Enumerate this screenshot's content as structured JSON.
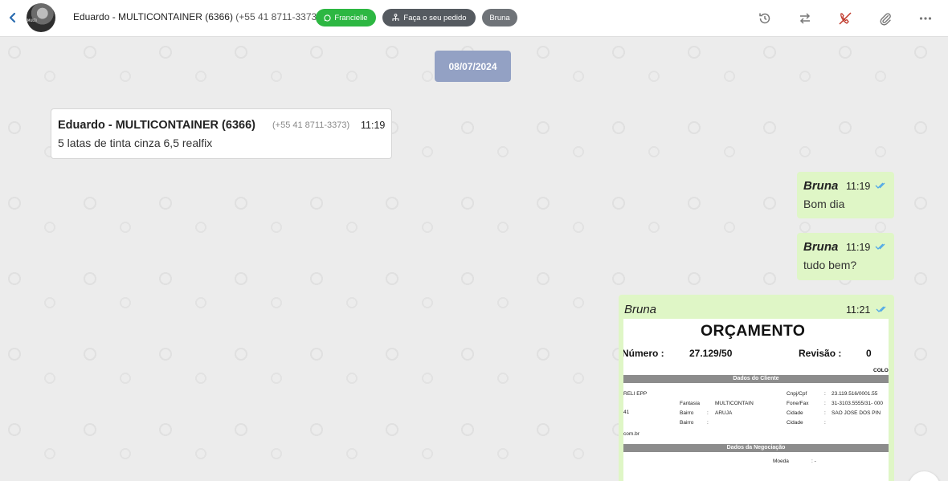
{
  "header": {
    "contact_name": "Eduardo - MULTICONTAINER (6366)",
    "contact_phone": "(+55 41 8711-3373)",
    "pill_whatsapp": "Francielle",
    "pill_order": "Faça o seu pedido",
    "pill_agent": "Bruna",
    "avatar_text": "MULTI",
    "icons": [
      "back-icon",
      "history-icon",
      "transfer-icon",
      "end-call-icon",
      "attachment-icon",
      "more-icon"
    ]
  },
  "chat": {
    "date": "08/07/2024",
    "incoming": {
      "sender": "Eduardo - MULTICONTAINER (6366)",
      "phone": "(+55 41 8711-3373)",
      "time": "11:19",
      "text": "5 latas de tinta cinza 6,5 realfix"
    },
    "outgoing": [
      {
        "sender": "Bruna",
        "time": "11:19",
        "text": "Bom dia"
      },
      {
        "sender": "Bruna",
        "time": "11:19",
        "text": "tudo bem?"
      },
      {
        "sender": "Bruna",
        "time": "11:21"
      }
    ],
    "tick_color": "#4fa8e8"
  },
  "document": {
    "title": "ORÇAMENTO",
    "number_label": "Número :",
    "number": "27.129/50",
    "revision_label": "Revisão :",
    "revision": "0",
    "col_label": "COLO",
    "section_client": "Dados do Cliente",
    "client_name": "RELI EPP",
    "fantasia_label": "Fantasia",
    "fantasia_value": "MULTICONTAIN",
    "bairro_label": "Bairro",
    "bairro_sep": ":",
    "bairro_value": "ARUJA",
    "bairro2_label": "Bairro",
    "bairro2_sep": ":",
    "cnpj_label": "Cnpj/Cpf",
    "cnpj_value": "23.119.516/0001.55",
    "fone_label": "Fone/Fax",
    "fone_value": "31-3103.5555/31- 000",
    "cidade_label": "Cidade",
    "cidade_value": "SAO JOSE DOS PIN",
    "cidade2_label": "Cidade",
    "colon": ":",
    "address_fragment": "41",
    "email_fragment": "com.br",
    "section_negotiation": "Dados da Negociação",
    "moeda_label": "Moeda",
    "moeda_value": ":  -"
  }
}
